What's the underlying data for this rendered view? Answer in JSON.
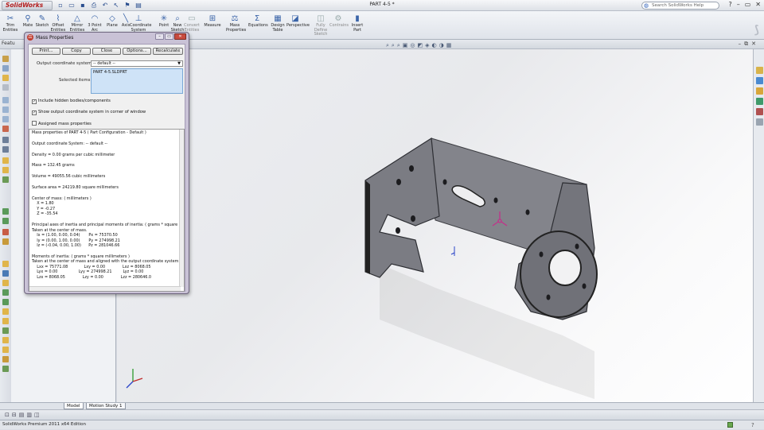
{
  "app": {
    "name": "SolidWorks",
    "doc_title": "PART 4-5 *",
    "help_placeholder": "Search SolidWorks Help"
  },
  "ribbon": {
    "tools": [
      {
        "label": "Trim\nEntities",
        "icon": "trim-icon",
        "glyph": "✂",
        "enabled": true
      },
      {
        "label": "Mate",
        "icon": "mate-icon",
        "glyph": "⚲",
        "enabled": true
      },
      {
        "label": "Sketch",
        "icon": "sketch-icon",
        "glyph": "✎",
        "enabled": true
      },
      {
        "label": "Offset\nEntities",
        "icon": "offset-icon",
        "glyph": "⌇",
        "enabled": true
      },
      {
        "label": "Mirror\nEntities",
        "icon": "mirror-icon",
        "glyph": "△",
        "enabled": true
      },
      {
        "label": "3 Point\nArc",
        "icon": "arc-icon",
        "glyph": "◠",
        "enabled": true
      },
      {
        "label": "Plane",
        "icon": "plane-icon",
        "glyph": "◇",
        "enabled": true
      },
      {
        "label": "Axis",
        "icon": "axis-icon",
        "glyph": "╲",
        "enabled": true
      },
      {
        "label": "Coordinate\nSystem",
        "icon": "coordinate-system-icon",
        "glyph": "⊥",
        "enabled": true
      },
      {
        "label": "Point",
        "icon": "point-icon",
        "glyph": "✳",
        "enabled": true
      },
      {
        "label": "New\nSketch",
        "icon": "new-sketch-icon",
        "glyph": "⌕",
        "enabled": true
      },
      {
        "label": "Convert\nEntities",
        "icon": "convert-icon",
        "glyph": "▭",
        "enabled": false
      },
      {
        "label": "Measure",
        "icon": "measure-icon",
        "glyph": "⊞",
        "enabled": true
      },
      {
        "label": "Mass\nProperties",
        "icon": "mass-properties-icon",
        "glyph": "⚖",
        "enabled": true
      },
      {
        "label": "Equations",
        "icon": "equations-icon",
        "glyph": "Σ",
        "enabled": true
      },
      {
        "label": "Design\nTable",
        "icon": "design-table-icon",
        "glyph": "▦",
        "enabled": true
      },
      {
        "label": "Perspective",
        "icon": "perspective-icon",
        "glyph": "◪",
        "enabled": true
      },
      {
        "label": "Fully\nDefine\nSketch",
        "icon": "fully-define-icon",
        "glyph": "◫",
        "enabled": false
      },
      {
        "label": "Contrains",
        "icon": "contrains-icon",
        "glyph": "⚙",
        "enabled": false
      },
      {
        "label": "Insert\nPart",
        "icon": "insert-part-icon",
        "glyph": "▮",
        "enabled": true
      }
    ]
  },
  "tabs": {
    "feature_manager": "Featu",
    "bottom": [
      "Model",
      "Motion Study 1"
    ]
  },
  "dialog": {
    "title": "Mass Properties",
    "buttons": {
      "print": "Print...",
      "copy": "Copy",
      "close": "Close",
      "options": "Options...",
      "recalculate": "Recalculate"
    },
    "coord_label": "Output coordinate system:",
    "coord_value": "-- default --",
    "selected_label": "Selected items:",
    "selected_value": "PART 4-5.SLDPRT",
    "checkboxes": [
      {
        "label": "Include hidden bodies/components",
        "checked": true
      },
      {
        "label": "Show output coordinate system in corner of window",
        "checked": true
      },
      {
        "label": "Assigned mass properties",
        "checked": false
      }
    ],
    "results": [
      "Mass properties of PART 4-5 ( Part Configuration - Default )",
      "",
      "Output coordinate System: -- default --",
      "",
      "Density = 0.00 grams per cubic millimeter",
      "",
      "Mass = 132.45 grams",
      "",
      "Volume = 49055.56 cubic millimeters",
      "",
      "Surface area = 24219.80 square millimeters",
      "",
      "Center of mass: ( millimeters )",
      "    X = 1.80",
      "    Y = -0.27",
      "    Z = -35.54",
      "",
      "Principal axes of inertia and principal moments of inertia: ( grams * square mil",
      "Taken at the center of mass.",
      "    Ix = (1.00, 0.00, 0.04)       Px = 75370.50",
      "    Iy = (0.00, 1.00, 0.00)       Py = 274998.21",
      "    Iz = (-0.04, 0.00, 1.00)      Pz = 281046.66",
      "",
      "Moments of inertia: ( grams * square millimeters )",
      "Taken at the center of mass and aligned with the output coordinate system.",
      "    Lxx = 75771.08             Lxy = 0.00              Lxz = 8068.05",
      "    Lyx = 0.00                 Lyy = 274998.21         Lyz = 0.00",
      "    Lzx = 8068.05              Lzy = 0.00              Lzz = 280646.0"
    ]
  },
  "status": {
    "text": "SolidWorks Premium 2011 x64 Edition"
  },
  "colors": {
    "accent": "#2b4f8f",
    "brand_red": "#b31d1d",
    "part_face": "#7b7c83",
    "selection_blue": "#cfe3f7"
  }
}
